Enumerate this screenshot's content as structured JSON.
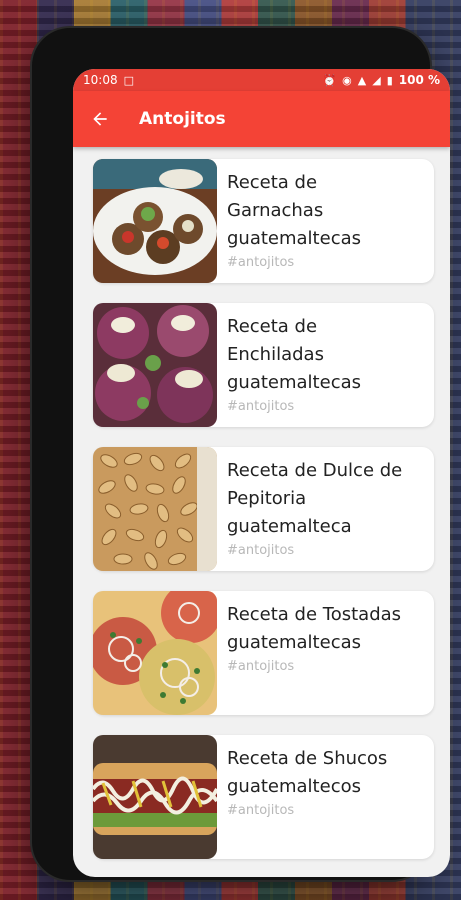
{
  "status_bar": {
    "time": "10:08",
    "battery": "100 %",
    "icons": [
      "laptop-icon",
      "alarm-icon",
      "eye-icon",
      "wifi-icon",
      "signal-icon",
      "battery-icon"
    ]
  },
  "app_bar": {
    "title": "Antojitos",
    "back_icon": "arrow-left-icon",
    "color": "#f44336"
  },
  "recipes": [
    {
      "title_lines": [
        "Receta de",
        "Garnachas",
        "guatemaltecas"
      ],
      "tag": "#antojitos",
      "image": "garnachas-photo"
    },
    {
      "title_lines": [
        "Receta de",
        "Enchiladas",
        "guatemaltecas"
      ],
      "tag": "#antojitos",
      "image": "enchiladas-photo"
    },
    {
      "title_lines": [
        "Receta de Dulce de",
        "Pepitoria",
        "guatemalteca"
      ],
      "tag": "#antojitos",
      "image": "pepitoria-photo"
    },
    {
      "title_lines": [
        "Receta de Tostadas",
        "guatemaltecas"
      ],
      "tag": "#antojitos",
      "image": "tostadas-photo"
    },
    {
      "title_lines": [
        "Receta de Shucos",
        "guatemaltecos"
      ],
      "tag": "#antojitos",
      "image": "shucos-photo"
    }
  ]
}
